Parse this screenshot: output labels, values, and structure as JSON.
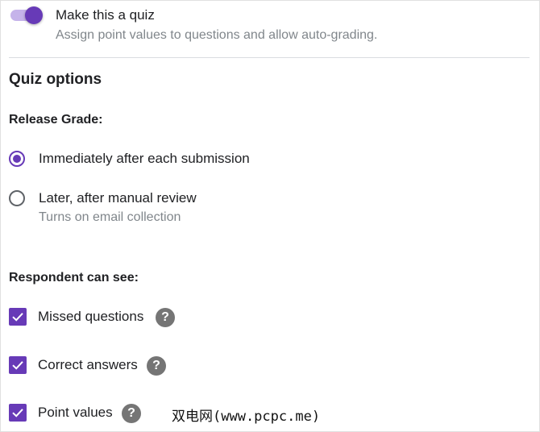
{
  "quiz_toggle": {
    "title": "Make this a quiz",
    "subtitle": "Assign point values to questions and allow auto-grading.",
    "on": true
  },
  "quiz_options": {
    "heading": "Quiz options",
    "release_grade": {
      "label": "Release Grade:",
      "options": [
        {
          "label": "Immediately after each submission",
          "selected": true
        },
        {
          "label": "Later, after manual review",
          "sublabel": "Turns on email collection",
          "selected": false
        }
      ]
    },
    "respondent_can_see": {
      "label": "Respondent can see:",
      "items": [
        {
          "label": "Missed questions",
          "checked": true
        },
        {
          "label": "Correct answers",
          "checked": true
        },
        {
          "label": "Point values",
          "checked": true
        }
      ]
    }
  },
  "icons": {
    "help": "?",
    "help_name": "help-icon",
    "check_name": "checkmark-icon"
  },
  "colors": {
    "accent": "#673ab7",
    "toggle_track": "#c5b3ea",
    "help_icon": "#757575",
    "secondary_text": "#80868b"
  },
  "watermark": "双电网(www.pcpc.me)"
}
